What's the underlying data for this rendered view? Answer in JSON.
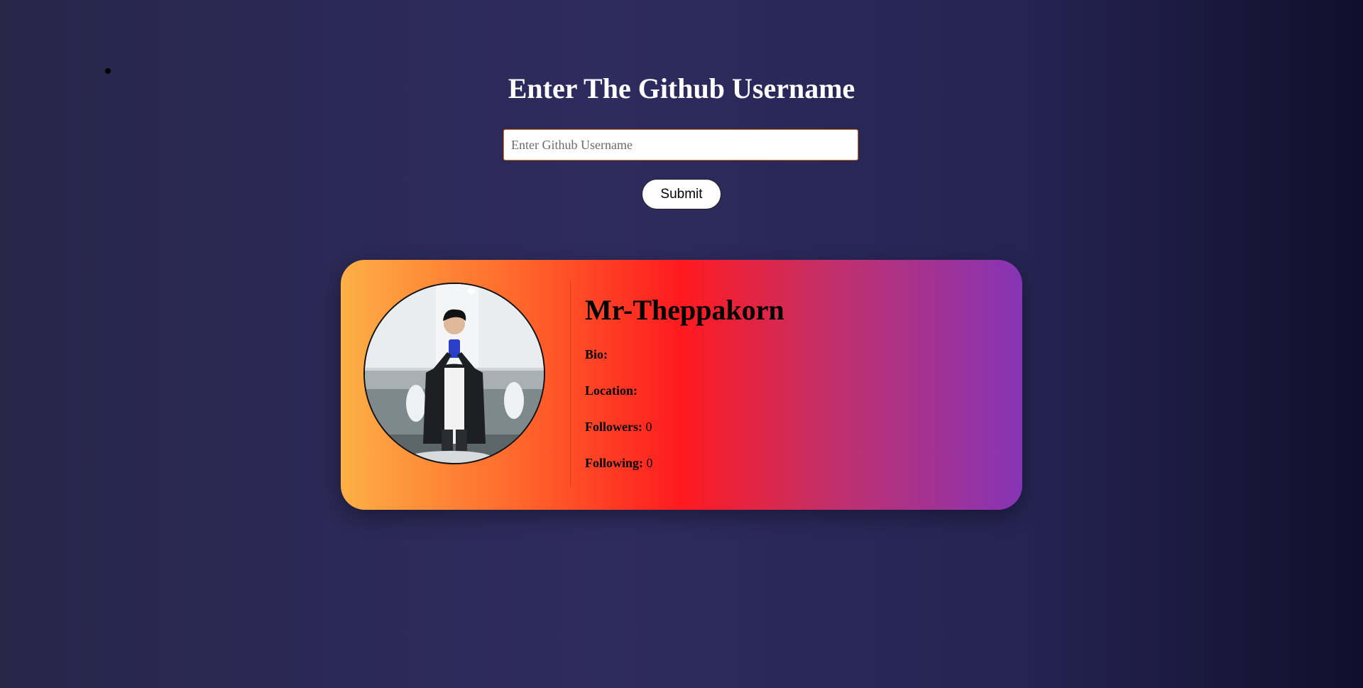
{
  "page": {
    "title": "Enter The Github Username"
  },
  "search": {
    "placeholder": "Enter Github Username",
    "value": ""
  },
  "submit": {
    "label": "Submit"
  },
  "profile": {
    "name": "Mr-Theppakorn",
    "bio_label": "Bio:",
    "bio_value": "",
    "location_label": "Location:",
    "location_value": "",
    "followers_label": "Followers:",
    "followers_value": "0",
    "following_label": "Following:",
    "following_value": "0",
    "avatar_icon": "user-avatar-photo"
  },
  "colors": {
    "background_start": "#272649",
    "background_end": "#100f2c",
    "card_gradient": [
      "#fdb046",
      "#ff1a1f",
      "#8634b6"
    ],
    "input_border": "#e07a1e"
  }
}
